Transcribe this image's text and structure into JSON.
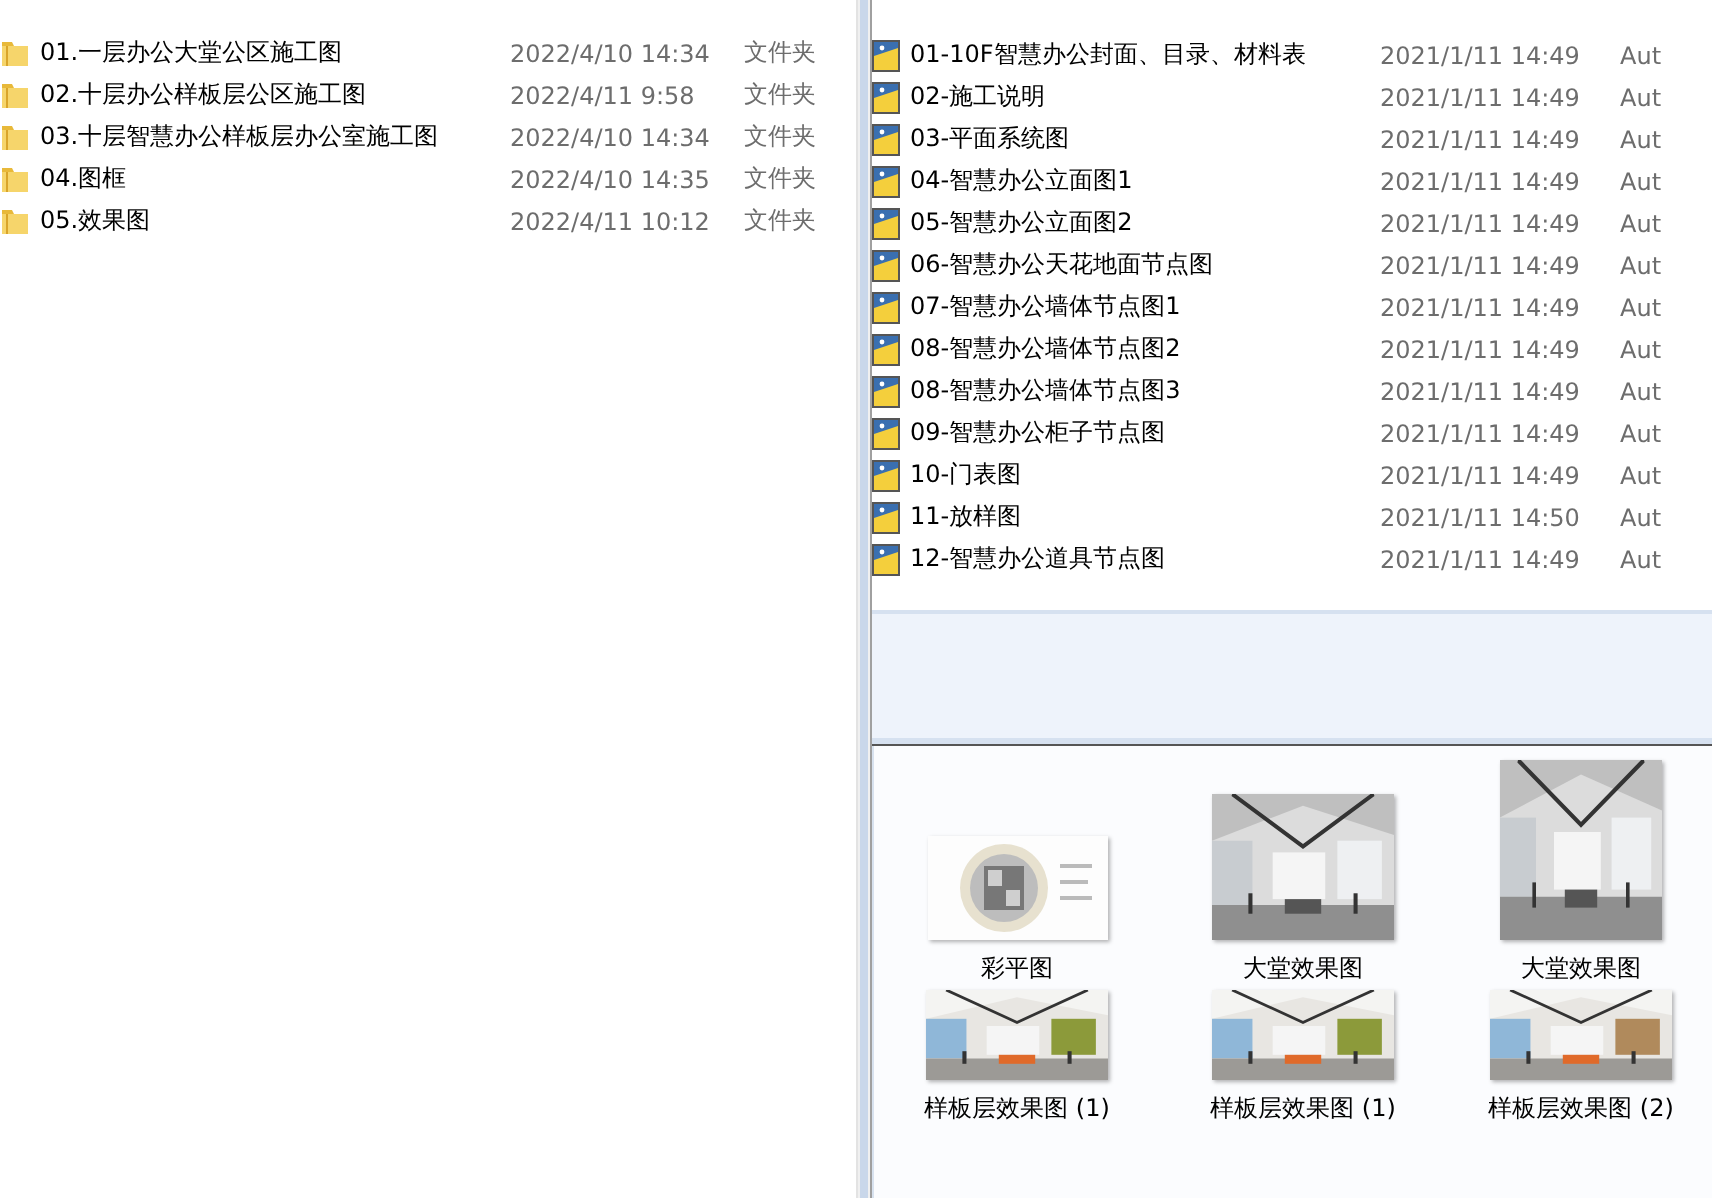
{
  "left_pane": {
    "rows": [
      {
        "name": "01.一层办公大堂公区施工图",
        "modified": "2022/4/10 14:34",
        "type": "文件夹"
      },
      {
        "name": "02.十层办公样板层公区施工图",
        "modified": "2022/4/11 9:58",
        "type": "文件夹"
      },
      {
        "name": "03.十层智慧办公样板层办公室施工图",
        "modified": "2022/4/10 14:34",
        "type": "文件夹"
      },
      {
        "name": "04.图框",
        "modified": "2022/4/10 14:35",
        "type": "文件夹"
      },
      {
        "name": "05.效果图",
        "modified": "2022/4/11 10:12",
        "type": "文件夹"
      }
    ]
  },
  "right_pane": {
    "rows": [
      {
        "name": "01-10F智慧办公封面、目录、材料表",
        "modified": "2021/1/11 14:49",
        "type": "Aut"
      },
      {
        "name": "02-施工说明",
        "modified": "2021/1/11 14:49",
        "type": "Aut"
      },
      {
        "name": "03-平面系统图",
        "modified": "2021/1/11 14:49",
        "type": "Aut"
      },
      {
        "name": "04-智慧办公立面图1",
        "modified": "2021/1/11 14:49",
        "type": "Aut"
      },
      {
        "name": "05-智慧办公立面图2",
        "modified": "2021/1/11 14:49",
        "type": "Aut"
      },
      {
        "name": "06-智慧办公天花地面节点图",
        "modified": "2021/1/11 14:49",
        "type": "Aut"
      },
      {
        "name": "07-智慧办公墙体节点图1",
        "modified": "2021/1/11 14:49",
        "type": "Aut"
      },
      {
        "name": "08-智慧办公墙体节点图2",
        "modified": "2021/1/11 14:49",
        "type": "Aut"
      },
      {
        "name": "08-智慧办公墙体节点图3",
        "modified": "2021/1/11 14:49",
        "type": "Aut"
      },
      {
        "name": "09-智慧办公柜子节点图",
        "modified": "2021/1/11 14:49",
        "type": "Aut"
      },
      {
        "name": "10-门表图",
        "modified": "2021/1/11 14:49",
        "type": "Aut"
      },
      {
        "name": "11-放样图",
        "modified": "2021/1/11 14:50",
        "type": "Aut"
      },
      {
        "name": "12-智慧办公道具节点图",
        "modified": "2021/1/11 14:49",
        "type": "Aut"
      }
    ]
  },
  "thumbnails": [
    {
      "label": "彩平图",
      "kind": "plan"
    },
    {
      "label": "大堂效果图",
      "kind": "picture"
    },
    {
      "label": "大堂效果图",
      "kind": "picture"
    },
    {
      "label": "样板层效果图 (1)",
      "kind": "picture"
    },
    {
      "label": "样板层效果图 (1)",
      "kind": "picture"
    },
    {
      "label": "样板层效果图 (2)",
      "kind": "picture"
    }
  ]
}
